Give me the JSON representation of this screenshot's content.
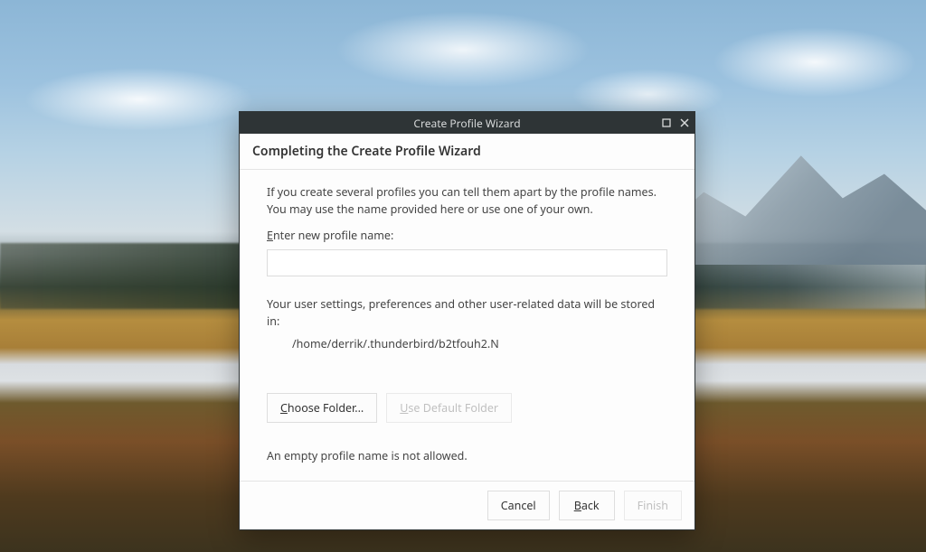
{
  "window": {
    "title": "Create Profile Wizard"
  },
  "heading": "Completing the Create Profile Wizard",
  "intro": "If you create several profiles you can tell them apart by the profile names. You may use the name provided here or use one of your own.",
  "profile_name": {
    "label_prefix": "E",
    "label_rest": "nter new profile name:",
    "value": ""
  },
  "storage": {
    "intro": "Your user settings, preferences and other user-related data will be stored in:",
    "path": "/home/derrik/.thunderbird/b2tfouh2.N"
  },
  "buttons": {
    "choose_folder_prefix": "C",
    "choose_folder_rest": "hoose Folder...",
    "use_default_prefix": "U",
    "use_default_rest": "se Default Folder"
  },
  "error": "An empty profile name is not allowed.",
  "footer": {
    "cancel": "Cancel",
    "back_prefix": "B",
    "back_rest": "ack",
    "finish": "Finish"
  }
}
